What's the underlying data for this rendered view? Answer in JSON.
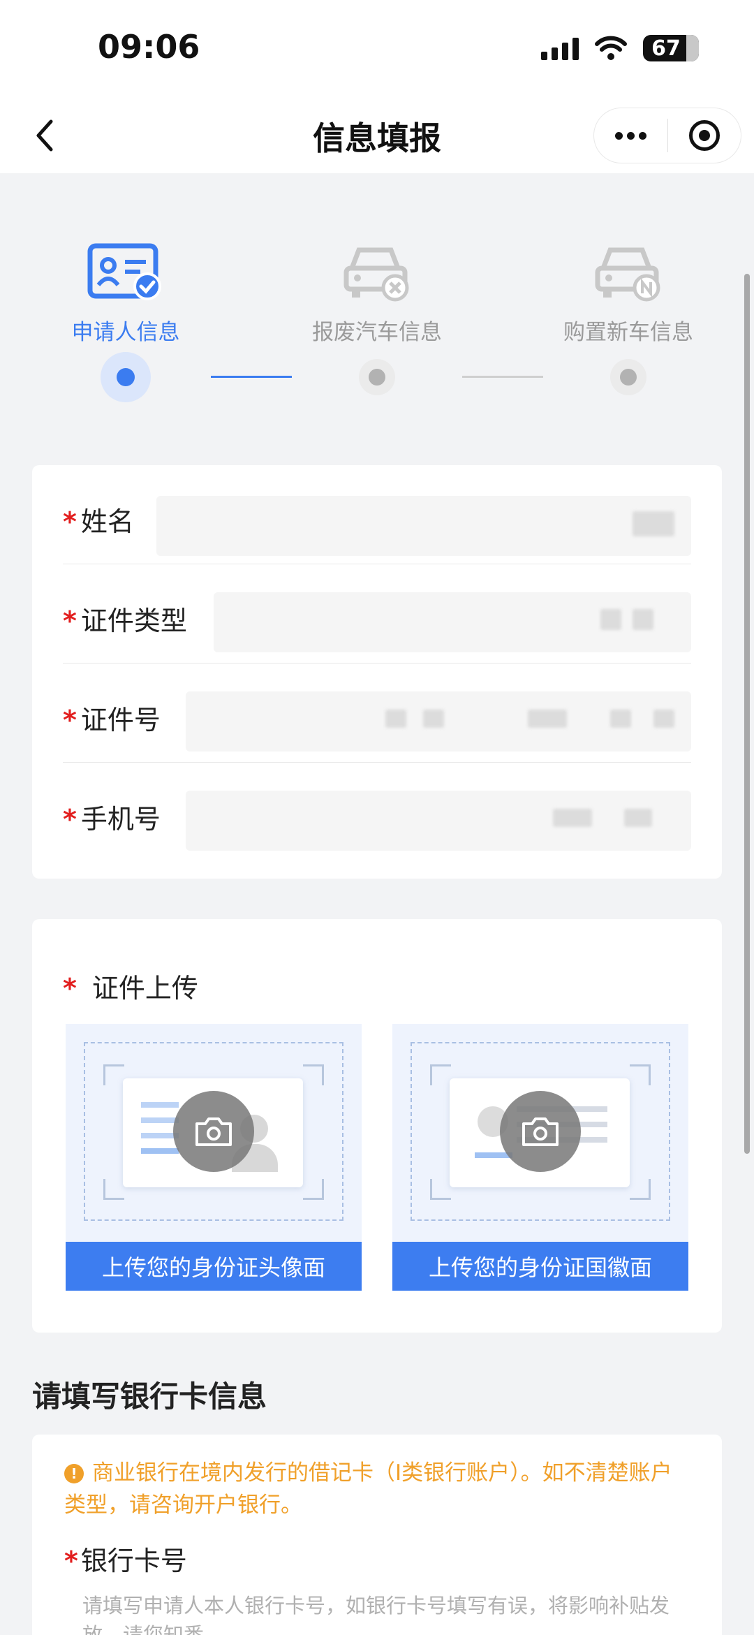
{
  "status_bar": {
    "time": "09:06",
    "battery": "67"
  },
  "nav": {
    "title": "信息填报"
  },
  "steps": [
    {
      "label": "申请人信息",
      "icon": "applicant-card-icon",
      "active": true
    },
    {
      "label": "报废汽车信息",
      "icon": "scrap-car-icon",
      "active": false
    },
    {
      "label": "购置新车信息",
      "icon": "new-car-icon",
      "active": false
    }
  ],
  "form": {
    "required_mark": "*",
    "name_label": "姓名",
    "id_type_label": "证件类型",
    "id_number_label": "证件号",
    "phone_label": "手机号"
  },
  "upload": {
    "title": "证件上传",
    "front_button": "上传您的身份证头像面",
    "back_button": "上传您的身份证国徽面"
  },
  "bank": {
    "heading": "请填写银行卡信息",
    "notice_icon": "info-icon",
    "notice": "商业银行在境内发行的借记卡（I类银行账户）。如不清楚账户类型，请咨询开户银行。",
    "card_label": "银行卡号",
    "card_placeholder": "请填写申请人本人银行卡号，如银行卡号填写有误，将影响补贴发放，请您知悉"
  },
  "colors": {
    "accent": "#3b7cf0",
    "required": "#e21e1e",
    "notice": "#f0a02a",
    "inactive": "#9a9a9a"
  }
}
